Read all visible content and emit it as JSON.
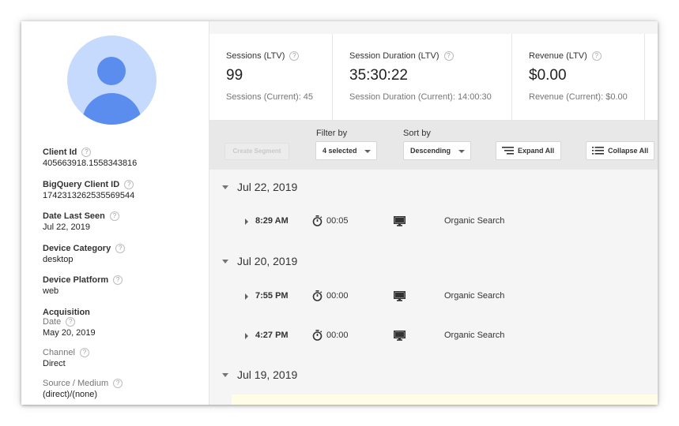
{
  "sidebar": {
    "fields": [
      {
        "label": "Client Id",
        "value": "405663918.1558343816"
      },
      {
        "label": "BigQuery Client ID",
        "value": "1742313262535569544"
      },
      {
        "label": "Date Last Seen",
        "value": "Jul 22, 2019"
      },
      {
        "label": "Device Category",
        "value": "desktop"
      },
      {
        "label": "Device Platform",
        "value": "web"
      }
    ],
    "acquisition": {
      "title": "Acquisition",
      "date_label": "Date",
      "date_value": "May 20, 2019",
      "channel_label": "Channel",
      "channel_value": "Direct",
      "source_label": "Source / Medium",
      "source_value": "(direct)/(none)"
    },
    "help_glyph": "?"
  },
  "stats": [
    {
      "title": "Sessions (LTV)",
      "value": "99",
      "current": "Sessions (Current): 45"
    },
    {
      "title": "Session Duration (LTV)",
      "value": "35:30:22",
      "current": "Session Duration (Current): 14:00:30"
    },
    {
      "title": "Revenue (LTV)",
      "value": "$0.00",
      "current": "Revenue (Current): $0.00"
    }
  ],
  "toolbar": {
    "create_segment": "Create Segment",
    "filter_label": "Filter by",
    "filter_value": "4 selected",
    "sort_label": "Sort by",
    "sort_value": "Descending",
    "expand_all": "Expand All",
    "collapse_all": "Collapse All"
  },
  "timeline": {
    "dates": [
      {
        "date": "Jul 22, 2019",
        "sessions": [
          {
            "time": "8:29 AM",
            "duration": "00:05",
            "device_icon": "desktop-icon",
            "source": "Organic Search"
          }
        ]
      },
      {
        "date": "Jul 20, 2019",
        "sessions": [
          {
            "time": "7:55 PM",
            "duration": "00:00",
            "device_icon": "desktop-icon",
            "source": "Organic Search"
          },
          {
            "time": "4:27 PM",
            "duration": "00:00",
            "device_icon": "desktop-icon",
            "source": "Organic Search"
          }
        ]
      },
      {
        "date": "Jul 19, 2019",
        "sessions": []
      }
    ]
  },
  "colors": {
    "avatar_bg": "#c5dafc",
    "avatar_fg": "#5b8def",
    "highlight": "#fffde7"
  }
}
